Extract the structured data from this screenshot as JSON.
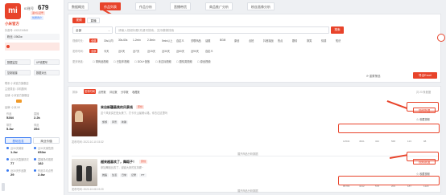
{
  "sidebar": {
    "id_label": "ID账号",
    "id_number": "679",
    "tags": [
      "蓝V认证号",
      "优质商户"
    ],
    "shop_name": "小米官方",
    "sub_id": "抖音号: 4321234543",
    "fans": "粉丝: 1962w",
    "actions": [
      "数据监控",
      "UP收藏号",
      "巡店",
      "数据分析"
    ],
    "actions_row2": [
      "复制链接",
      "数据对比"
    ],
    "contact": "联系 小米官方旗舰店",
    "rows": [
      "主营类目: 手机数码",
      "店铺: 小米官方旗舰店",
      "品牌: 小米 MI"
    ],
    "stats": [
      {
        "label": "作品",
        "value": "5284"
      },
      {
        "label": "直播",
        "value": "2.2k"
      },
      {
        "label": "带货",
        "value": "5.3w"
      },
      {
        "label": "商品",
        "value": "394"
      }
    ],
    "tabs": [
      "基础信息",
      "商业价值"
    ],
    "metrics": [
      {
        "label": "近30天销量",
        "value": "1.2w"
      },
      {
        "label": "近30天销售额",
        "value": "652w"
      },
      {
        "label": "近30天直播场次",
        "value": "77"
      },
      {
        "label": "直播场均观看",
        "value": "182"
      },
      {
        "label": "近30天作品数",
        "value": "29"
      },
      {
        "label": "作品平均点赞",
        "value": "2.4w"
      }
    ]
  },
  "topnav": {
    "tabs": [
      "数据概览",
      "作品列表",
      "作品分析",
      "直播带货",
      "商品推广分析",
      "粉丝画像分析"
    ],
    "active": 1
  },
  "filter": {
    "seg_tabs": [
      "视频",
      "直播"
    ],
    "select_value": "全部",
    "search_placeholder": "请输入视频标题/关键词搜索，支持模糊搜索",
    "search_btn": "搜索",
    "rows": [
      {
        "label": "视频时长:",
        "options": [
          "全部",
          "30s以内",
          "30s-60s",
          "1-2min",
          "2-5min",
          "5min以上",
          "自定义",
          "关联商品",
          "话题",
          "BGM",
          "原创",
          "合拍",
          "抖音挑战",
          "热点",
          "剧情",
          "搞笑",
          "情感",
          "知识"
        ]
      },
      {
        "label": "发布时间:",
        "options": [
          "全部",
          "今天",
          "近3天",
          "近7天",
          "近15天",
          "近30天",
          "近60天",
          "近90天",
          "自定义"
        ]
      },
      {
        "label": "更多筛选:",
        "options": [
          "带商品视频",
          "已挂车视频",
          "DOU+投放",
          "未达标视频",
          "剧情类视频",
          "原创视频"
        ]
      }
    ],
    "reset": "重置筛选",
    "export": "导出Excel"
  },
  "sort": {
    "label": "排序:",
    "options": [
      "发布时间",
      "点赞数",
      "评论数",
      "分享数",
      "收藏数"
    ],
    "total": "共 23 条数据"
  },
  "videos": [
    {
      "title": "来自新疆最美的风景线",
      "badge": "原创",
      "desc": "这个风景实在是太美了，打卡天山最美公路，你去过这里吗",
      "tags": [
        "旅游",
        "风景",
        "新疆"
      ],
      "time": "发布时间: 2022-10-10 15:32",
      "btn_data": "视频数据",
      "btn_fav": "收藏视频",
      "metrics": [
        "12534",
        "4521",
        "342",
        "568",
        "123",
        "98"
      ],
      "expand": "展开商品分析数据"
    },
    {
      "title": "越来越喜欢了，舞蹈子！",
      "badge": "原创",
      "desc": "参加舞蹈比赛了，谢谢大家的支持喔~",
      "tags": [
        "舞蹈",
        "生活",
        "日常",
        "记录",
        "ITT"
      ],
      "time": "发布时间: 2022-10-08 19:20",
      "btn_data": "视频数据",
      "btn_fav": "收藏视频",
      "metrics": [
        "85765",
        "4212",
        "578",
        "203",
        "187",
        "1120"
      ],
      "expand": "展开商品分析数据"
    }
  ],
  "colors": {
    "accent": "#e8432a",
    "bg": "#eef0f3"
  }
}
